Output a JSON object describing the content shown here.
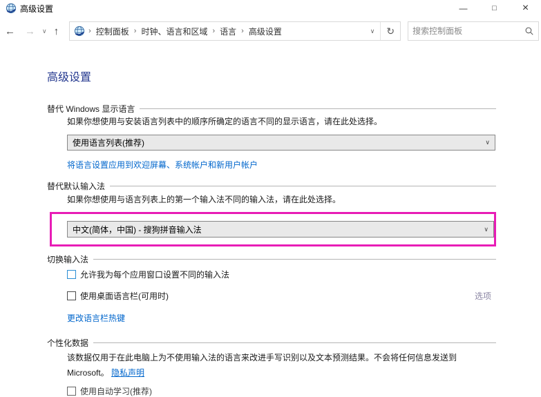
{
  "window": {
    "title": "高级设置"
  },
  "icons": {
    "back": "←",
    "forward": "→",
    "recent_chevron": "∨",
    "up": "↑",
    "breadcrumb_separator": "›",
    "address_chevron": "∨",
    "refresh": "↻",
    "dropdown_chevron": "∨",
    "minimize": "—",
    "maximize": "□",
    "close": "×"
  },
  "navbar": {
    "breadcrumb": [
      "控制面板",
      "时钟、语言和区域",
      "语言",
      "高级设置"
    ],
    "search_placeholder": "搜索控制面板"
  },
  "page": {
    "heading": "高级设置",
    "display_language": {
      "title": "替代 Windows 显示语言",
      "description": "如果你想使用与安装语言列表中的顺序所确定的语言不同的显示语言，请在此处选择。",
      "dropdown_value": "使用语言列表(推荐)",
      "apply_link": "将语言设置应用到欢迎屏幕、系统帐户和新用户帐户"
    },
    "default_input_method": {
      "title": "替代默认输入法",
      "description": "如果你想使用与语言列表上的第一个输入法不同的输入法，请在此处选择。",
      "dropdown_value": "中文(简体，中国) - 搜狗拼音输入法",
      "highlighted": true
    },
    "switching_input_methods": {
      "title": "切换输入法",
      "checkbox_per_app": {
        "label": "允许我为每个应用窗口设置不同的输入法",
        "checked": false
      },
      "checkbox_language_bar": {
        "label": "使用桌面语言栏(可用时)",
        "checked": false
      },
      "options_link": "选项",
      "hotkeys_link": "更改语言栏热键"
    },
    "personalization_data": {
      "title": "个性化数据",
      "description_line1": "该数据仅用于在此电脑上为不使用输入法的语言来改进手写识别以及文本预测结果。不会将任何信息发送到",
      "description_line2_prefix": "Microsoft。",
      "privacy_link": "隐私声明",
      "cutoff_option": {
        "label": "使用自动学习(推荐)",
        "checked": false
      }
    }
  },
  "colors": {
    "heading": "#24388f",
    "link": "#0066cc",
    "highlight_box": "#e81cb6",
    "options_link": "#8a85a3",
    "dropdown_bg": "#e9e9e9",
    "checkbox_focus": "#2a8dd4"
  }
}
